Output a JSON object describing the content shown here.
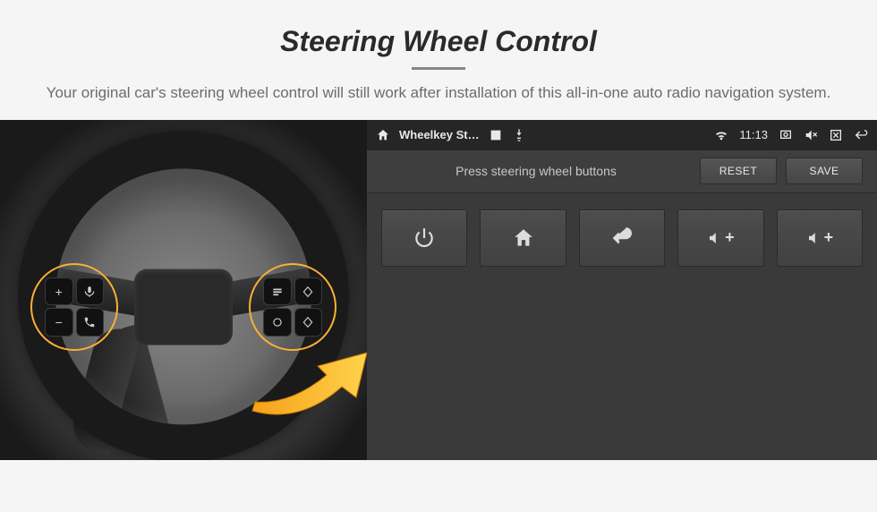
{
  "header": {
    "title": "Steering Wheel Control",
    "subtitle": "Your original car's steering wheel control will still work after installation of this all-in-one auto radio navigation system."
  },
  "wheel": {
    "left_cluster": [
      "+",
      "voice",
      "−",
      "phone"
    ],
    "right_cluster": [
      "source",
      "up",
      "cycle",
      "down"
    ]
  },
  "screen": {
    "status": {
      "app_title": "Wheelkey St…",
      "time": "11:13"
    },
    "subbar": {
      "instruction": "Press steering wheel buttons",
      "reset": "RESET",
      "save": "SAVE"
    },
    "buttons": {
      "vol_plus_a": "+",
      "vol_plus_b": "+"
    }
  }
}
